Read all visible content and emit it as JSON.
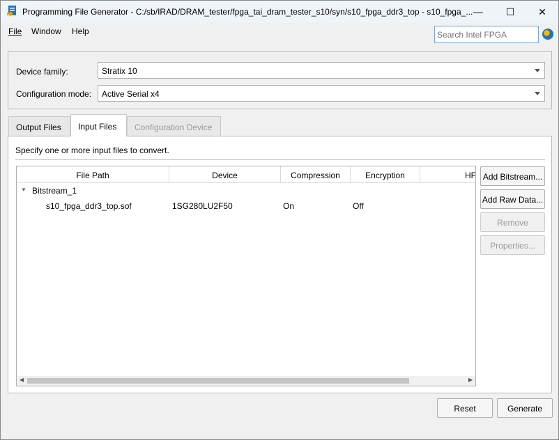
{
  "window": {
    "title": "Programming File Generator - C:/sb/IRAD/DRAM_tester/fpga_tai_dram_tester_s10/syn/s10_fpga_ddr3_top - s10_fpga_...",
    "minimize": "—",
    "maximize": "☐",
    "close": "✕"
  },
  "menu": [
    "File",
    "Window",
    "Help"
  ],
  "search": {
    "placeholder": "Search Intel FPGA"
  },
  "device": {
    "family_label": "Device family:",
    "family_value": "Stratix 10",
    "mode_label": "Configuration mode:",
    "mode_value": "Active Serial x4"
  },
  "tabs": [
    {
      "label": "Output Files"
    },
    {
      "label": "Input Files"
    },
    {
      "label": "Configuration Device"
    }
  ],
  "panel": {
    "instruction": "Specify one or more input files to convert."
  },
  "table": {
    "columns": [
      "File Path",
      "Device",
      "Compression",
      "Encryption",
      "HF"
    ],
    "group": "Bitstream_1",
    "rows": [
      {
        "path": "s10_fpga_ddr3_top.sof",
        "device": "1SG280LU2F50",
        "compression": "On",
        "encryption": "Off"
      }
    ]
  },
  "side_buttons": {
    "add_bitstream": "Add Bitstream...",
    "add_raw": "Add Raw Data...",
    "remove": "Remove",
    "properties": "Properties..."
  },
  "footer": {
    "reset": "Reset",
    "generate": "Generate"
  }
}
